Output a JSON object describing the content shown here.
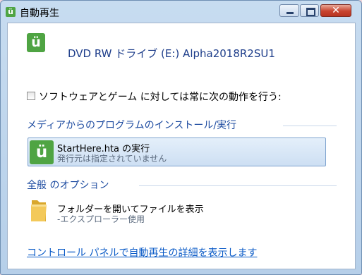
{
  "window": {
    "title": "自動再生",
    "controls": {
      "minimize": "minimize",
      "maximize": "maximize",
      "close": "close"
    }
  },
  "device": {
    "title": "DVD RW ドライブ (E:) Alpha2018R2SU1",
    "icon": "autoplay-icon"
  },
  "always_do": {
    "label": "ソフトウェアとゲーム に対しては常に次の動作を行う:",
    "checked": false
  },
  "sections": [
    {
      "title": "メディアからのプログラムのインストール/実行",
      "options": [
        {
          "title": "StartHere.hta の実行",
          "subtitle": "発行元は指定されていません",
          "icon": "autoplay-icon",
          "selected": true
        }
      ]
    },
    {
      "title": "全般 のオプション",
      "options": [
        {
          "title": "フォルダーを開いてファイルを表示",
          "subtitle": "-エクスプローラー使用",
          "icon": "folder-icon",
          "selected": false
        }
      ]
    }
  ],
  "footer_link": "コントロール パネルで自動再生の詳細を表示します",
  "colors": {
    "accent_green": "#4fa443",
    "link_blue": "#0b5bc7",
    "heading_blue": "#1d4ba0"
  }
}
